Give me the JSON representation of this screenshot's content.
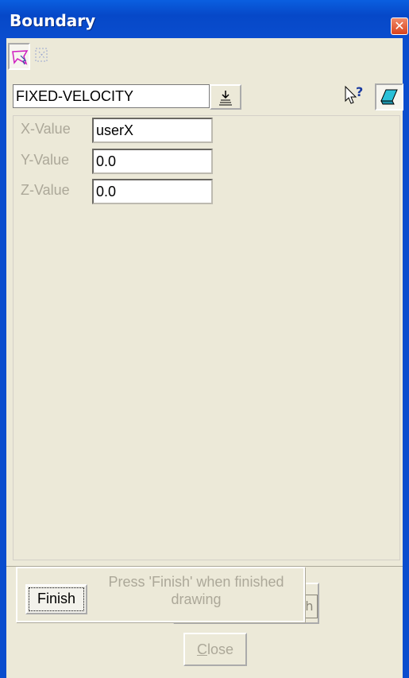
{
  "window": {
    "title": "Boundary",
    "close_glyph": "✕"
  },
  "modes": [
    {
      "icon": "select-polygon-icon",
      "active": true
    },
    {
      "icon": "select-region-icon",
      "active": false
    }
  ],
  "boundary_type": {
    "value": "FIXED-VELOCITY",
    "dropdown_icon": "dropdown-arrow-icon"
  },
  "tools": [
    {
      "icon": "help-pointer-icon"
    },
    {
      "icon": "surface-icon"
    }
  ],
  "fields": [
    {
      "label": "X-Value",
      "value": "userX"
    },
    {
      "label": "Y-Value",
      "value": "0.0"
    },
    {
      "label": "Z-Value",
      "value": "0.0"
    }
  ],
  "finish_popup": {
    "button_label": "Finish",
    "message_line1": "Press 'Finish' when finished",
    "message_line2": "drawing"
  },
  "hidden_button_stub": "h",
  "close_button": {
    "accel": "C",
    "rest": "lose"
  },
  "colors": {
    "title_bar": "#0a4dce",
    "window_bg": "#ece9d8",
    "disabled_text": "#aca899"
  }
}
